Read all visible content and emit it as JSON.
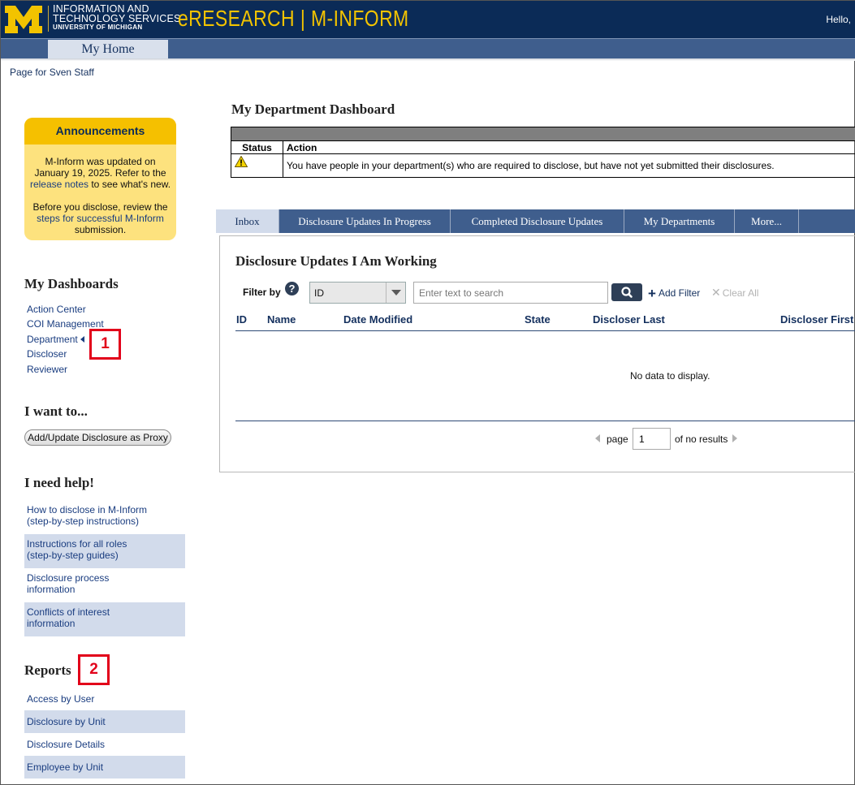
{
  "header": {
    "logo_letter": "M",
    "its_line1": "INFORMATION AND",
    "its_line2": "TECHNOLOGY SERVICES",
    "its_line3": "UNIVERSITY OF MICHIGAN",
    "app_title": "eRESEARCH  |  M-INFORM",
    "greeting": "Hello,",
    "colors": {
      "navy": "#0b2b57",
      "maize": "#f2c300"
    }
  },
  "nav": {
    "tab_label": "My Home"
  },
  "page_for": "Page for Sven Staff",
  "announcements": {
    "title": "Announcements",
    "p1_pre": "M-Inform was updated on January 19, 2025. Refer to the ",
    "p1_link": "release notes",
    "p1_post": " to see what's new.",
    "p2_pre": "Before you disclose, review the ",
    "p2_link": "steps for successful M-Inform",
    "p2_post": " submission."
  },
  "dashboards": {
    "heading": "My Dashboards",
    "items": [
      "Action Center",
      "COI Management",
      "Department",
      "Discloser",
      "Reviewer"
    ]
  },
  "i_want_to": {
    "heading": "I want to...",
    "button": "Add/Update Disclosure as Proxy"
  },
  "help": {
    "heading": "I need help!",
    "items": [
      {
        "line1": "How to disclose in M-Inform",
        "line2": "(step-by-step instructions)"
      },
      {
        "line1": "Instructions for all roles",
        "line2": "(step-by-step guides)"
      },
      {
        "line1": "Disclosure process",
        "line2": "information"
      },
      {
        "line1": "Conflicts of interest",
        "line2": "information"
      }
    ]
  },
  "reports": {
    "heading": "Reports",
    "items": [
      "Access by User",
      "Disclosure by Unit",
      "Disclosure Details",
      "Employee by Unit"
    ]
  },
  "callouts": [
    "1",
    "2"
  ],
  "dashboard": {
    "title": "My Department Dashboard",
    "col_status": "Status",
    "col_action": "Action",
    "row_action": "You have people in your department(s) who are required to disclose, but have not yet submitted their disclosures."
  },
  "tabs": [
    "Inbox",
    "Disclosure Updates In Progress",
    "Completed Disclosure Updates",
    "My Departments",
    "More..."
  ],
  "panel": {
    "title": "Disclosure Updates I Am Working",
    "filter_label": "Filter by",
    "filter_value": "ID",
    "search_placeholder": "Enter text to search",
    "add_filter": "Add Filter",
    "clear_all": "Clear All",
    "columns": [
      "ID",
      "Name",
      "Date Modified",
      "State",
      "Discloser Last",
      "Discloser First"
    ],
    "empty_message": "No data to display.",
    "page_label": "page",
    "page_value": "1",
    "of_results": "of no results"
  }
}
